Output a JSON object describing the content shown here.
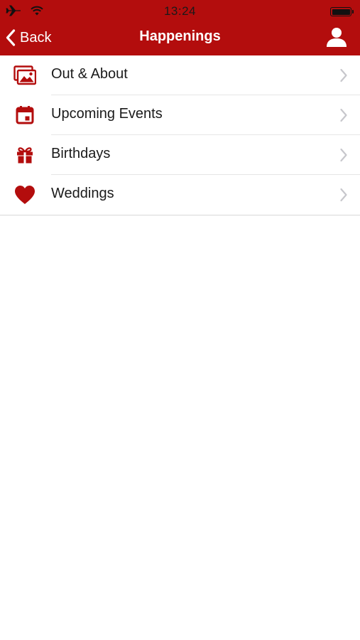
{
  "colors": {
    "accent": "#b30d0d",
    "text": "#1a1a1a",
    "chevron": "#c7c7cc"
  },
  "status_bar": {
    "time": "13:24",
    "left_icons": [
      "airplane-icon",
      "wifi-icon"
    ],
    "right_icons": [
      "battery-icon"
    ]
  },
  "nav": {
    "back_label": "Back",
    "title": "Happenings",
    "right_icon": "person-icon"
  },
  "menu": {
    "items": [
      {
        "label": "Out & About",
        "icon": "photos-icon"
      },
      {
        "label": "Upcoming Events",
        "icon": "calendar-icon"
      },
      {
        "label": "Birthdays",
        "icon": "gift-icon"
      },
      {
        "label": "Weddings",
        "icon": "heart-icon"
      }
    ]
  }
}
